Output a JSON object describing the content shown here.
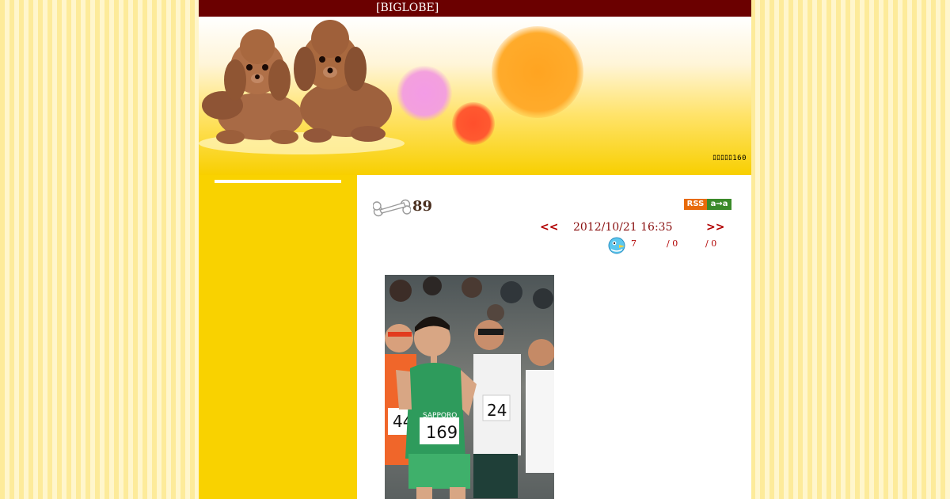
{
  "header": {
    "topbar_text": "[BIGLOBE]",
    "counter_text": "ﾛﾛﾛﾛﾛ160"
  },
  "entry": {
    "title": "89",
    "prev_link": "<<",
    "date": "2012/10/21 16:35",
    "next_link": ">>",
    "stats": {
      "first": "7",
      "second": "/ 0",
      "third": "/ 0"
    },
    "rss_badge": {
      "left": "RSS",
      "right": "a→a"
    }
  },
  "photo": {
    "bibs": [
      "44",
      "169",
      "24"
    ],
    "shirt_text": "SAPPORO"
  },
  "colors": {
    "topbar": "#6b0000",
    "page": "#f9d200",
    "link": "#b10000"
  },
  "icons": [
    "dogs-illustration",
    "bone-icon",
    "rss-icon",
    "bird-icon"
  ]
}
